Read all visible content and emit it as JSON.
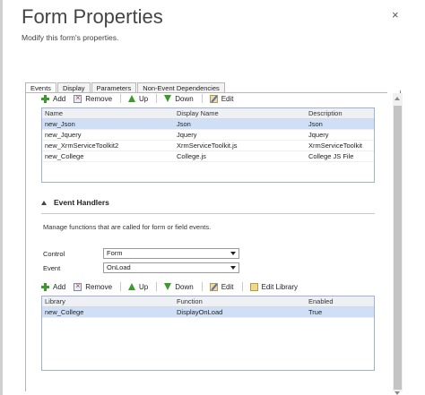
{
  "window": {
    "title": "Form Properties",
    "subtitle": "Modify this form's properties.",
    "close_glyph": "×"
  },
  "tabs": [
    {
      "label": "Events",
      "active": true
    },
    {
      "label": "Display",
      "active": false
    },
    {
      "label": "Parameters",
      "active": false
    },
    {
      "label": "Non-Event Dependencies",
      "active": false
    }
  ],
  "libraries_toolbar": {
    "add": "Add",
    "remove": "Remove",
    "up": "Up",
    "down": "Down",
    "edit": "Edit"
  },
  "libraries_table": {
    "headers": [
      "Name",
      "Display Name",
      "Description"
    ],
    "rows": [
      {
        "name": "new_Json",
        "display_name": "Json",
        "description": "Json",
        "selected": true
      },
      {
        "name": "new_Jquery",
        "display_name": "Jquery",
        "description": "Jquery",
        "selected": false
      },
      {
        "name": "new_XrmServiceToolkit2",
        "display_name": "XrmServiceToolkit.js",
        "description": "XrmServiceToolkit",
        "selected": false
      },
      {
        "name": "new_College",
        "display_name": "College.js",
        "description": "College JS File",
        "selected": false
      }
    ]
  },
  "event_handlers": {
    "title": "Event Handlers",
    "description": "Manage functions that are called for form or field events.",
    "control_label": "Control",
    "control_value": "Form",
    "event_label": "Event",
    "event_value": "OnLoad"
  },
  "handlers_toolbar": {
    "add": "Add",
    "remove": "Remove",
    "up": "Up",
    "down": "Down",
    "edit": "Edit",
    "edit_library": "Edit Library"
  },
  "handlers_table": {
    "headers": [
      "Library",
      "Function",
      "Enabled"
    ],
    "rows": [
      {
        "library": "new_College",
        "function": "DisplayOnLoad",
        "enabled": "True",
        "selected": true
      }
    ]
  },
  "colors": {
    "selection": "#cfe0f6",
    "green_icon": "#3a9a2a",
    "grid_border": "#9fb2cf"
  },
  "icons": [
    "plus-icon",
    "remove-icon",
    "arrow-up-icon",
    "arrow-down-icon",
    "edit-icon",
    "edit-library-icon",
    "collapse-triangle-icon",
    "close-icon"
  ]
}
